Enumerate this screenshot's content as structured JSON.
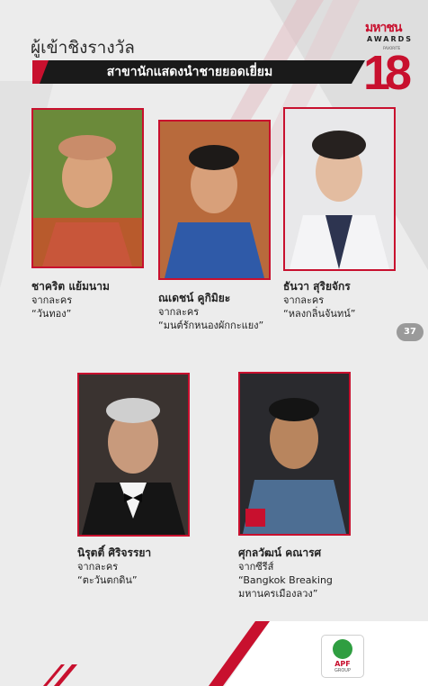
{
  "header": {
    "title": "ผู้เข้าชิงรางวัล",
    "category": "สาขานักแสดงนำชายยอดเยี่ยม"
  },
  "logo": {
    "brand": "มหาชน",
    "awards": "AWARDS",
    "favorite": "FAVORITE",
    "number": "18"
  },
  "nominees": [
    {
      "name": "ชาคริต แย้มนาม",
      "source": "จากละคร",
      "work": "“วันทอง”"
    },
    {
      "name": "ณเดชน์ คูกิมิยะ",
      "source": "จากละคร",
      "work": "“มนต์รักหนองผักกะแยง”"
    },
    {
      "name": "ธันวา สุริยจักร",
      "source": "จากละคร",
      "work": "“หลงกลิ่นจันทน์”"
    },
    {
      "name": "นิรุตติ์ ศิริจรรยา",
      "source": "จากละคร",
      "work": "“ตะวันตกดิน”"
    },
    {
      "name": "ศุกลวัฒน์ คณารศ",
      "source": "จากซีรีส์",
      "work": "“Bangkok Breaking",
      "work2": "มหานครเมืองลวง”"
    }
  ],
  "page_number": "37",
  "footer": {
    "logo_text": "APF",
    "logo_sub": "GROUP"
  },
  "colors": {
    "accent": "#c8102e",
    "dark": "#1a1a1a",
    "background": "#ececec"
  }
}
